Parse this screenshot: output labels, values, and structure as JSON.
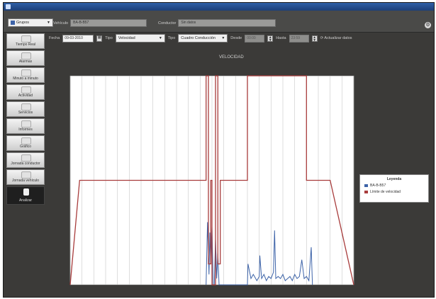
{
  "app": {
    "title": ""
  },
  "toolbar": {
    "group_select": "Grupos",
    "vehicle_label": "Vehículo",
    "vehicle_value": "BA-B-B57",
    "driver_label": "Conductor",
    "driver_value": "Sin datos"
  },
  "sidebar": {
    "items": [
      {
        "label": "Tiempo Real"
      },
      {
        "label": "Alarmas"
      },
      {
        "label": "Minuto a minuto"
      },
      {
        "label": "Actividad"
      },
      {
        "label": "Servicios"
      },
      {
        "label": "Informes"
      },
      {
        "label": "Gráfico"
      },
      {
        "label": "Jornada conductor"
      },
      {
        "label": "Jornada vehículo"
      },
      {
        "label": "Analizar"
      }
    ]
  },
  "filters": {
    "date_label": "Fecha",
    "date_value": "09-03-2010",
    "type1_label": "Tipo",
    "type1_value": "Velocidad",
    "type2_label": "Tipo",
    "type2_value": "Cuadro Conducción",
    "from_label": "Desde",
    "from_value": "00:00",
    "to_label": "Hasta",
    "to_value": "23:59",
    "refresh_label": "Actualizar datos"
  },
  "chart_data": {
    "type": "line",
    "title": "VELOCIDAD",
    "xlabel": "",
    "ylabel": "",
    "ylim": [
      0,
      100
    ],
    "xlim": [
      0,
      24
    ],
    "legend_position": "right",
    "legend_title": "Leyenda",
    "series": [
      {
        "name": "BA-B-B57",
        "color": "#3d63a8",
        "x": [
          11.5,
          11.62,
          11.75,
          11.82,
          11.9,
          12.0,
          12.1,
          12.2,
          12.3,
          12.4,
          12.5,
          12.6,
          12.7,
          15.0,
          15.05,
          15.3,
          15.5,
          15.8,
          16.0,
          16.05,
          16.2,
          16.4,
          16.6,
          16.8,
          17.0,
          17.2,
          17.3,
          17.4,
          17.6,
          17.8,
          18.0,
          18.2,
          18.4,
          18.6,
          18.8,
          19.0,
          19.2,
          19.4,
          19.6,
          19.8,
          20.0,
          20.2,
          20.4,
          20.5
        ],
        "y": [
          0,
          30,
          5,
          25,
          10,
          28,
          0,
          0,
          22,
          3,
          15,
          0,
          0,
          0,
          10,
          3,
          5,
          2,
          4,
          14,
          3,
          5,
          2,
          4,
          3,
          6,
          26,
          3,
          4,
          3,
          5,
          2,
          3,
          4,
          2,
          5,
          3,
          4,
          12,
          3,
          4,
          2,
          18,
          0
        ]
      },
      {
        "name": "Límite de velocidad",
        "color": "#a83c3c",
        "x": [
          0,
          0.8,
          11.5,
          11.5,
          11.7,
          11.7,
          11.9,
          11.9,
          12.0,
          12.0,
          12.3,
          12.3,
          12.5,
          12.5,
          12.7,
          12.7,
          15.0,
          15.0,
          20.0,
          20.0,
          22.0,
          24.0
        ],
        "y": [
          0,
          50,
          50,
          100,
          100,
          10,
          10,
          50,
          50,
          0,
          0,
          100,
          100,
          10,
          10,
          50,
          50,
          100,
          100,
          50,
          50,
          0
        ]
      }
    ]
  }
}
